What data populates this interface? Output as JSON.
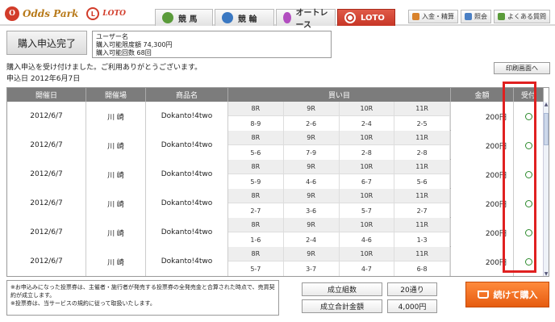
{
  "brand": {
    "logo": "Odds Park",
    "sub_logo": "LOTO"
  },
  "nav": [
    {
      "label": "競 馬",
      "icon": "horse-icon"
    },
    {
      "label": "競 輪",
      "icon": "bicycle-icon"
    },
    {
      "label": "オートレース",
      "icon": "motorcycle-icon"
    },
    {
      "label": "LOTO",
      "icon": "loto-icon",
      "active": true
    }
  ],
  "util": [
    {
      "label": "入金・精算",
      "icon": "yen-icon"
    },
    {
      "label": "照会",
      "icon": "document-icon"
    },
    {
      "label": "よくある質問",
      "icon": "help-icon"
    }
  ],
  "page": {
    "complete_label": "購入申込完了",
    "user_name_label": "ユーザー名",
    "limit_amount": "購入可能限度額 74,300円",
    "limit_count": "購入可能回数 68回",
    "message": "購入申込を受け付けました。ご利用ありがとうございます。",
    "date_line": "申込日 2012年6月7日",
    "print_label": "印刷画面へ"
  },
  "table": {
    "headers": {
      "date": "開催日",
      "venue": "開催場",
      "product": "商品名",
      "buy": "買い目",
      "amount": "金額",
      "status": "受付"
    },
    "rows": [
      {
        "date": "2012/6/7",
        "venue": "川 崎",
        "product": "Dokanto!4two",
        "races": [
          "8R",
          "9R",
          "10R",
          "11R"
        ],
        "picks": [
          "8-9",
          "2-6",
          "2-4",
          "2-5"
        ],
        "amount": "200円",
        "status": "○"
      },
      {
        "date": "2012/6/7",
        "venue": "川 崎",
        "product": "Dokanto!4two",
        "races": [
          "8R",
          "9R",
          "10R",
          "11R"
        ],
        "picks": [
          "5-6",
          "7-9",
          "2-8",
          "2-8"
        ],
        "amount": "200円",
        "status": "○"
      },
      {
        "date": "2012/6/7",
        "venue": "川 崎",
        "product": "Dokanto!4two",
        "races": [
          "8R",
          "9R",
          "10R",
          "11R"
        ],
        "picks": [
          "5-9",
          "4-6",
          "6-7",
          "5-6"
        ],
        "amount": "200円",
        "status": "○"
      },
      {
        "date": "2012/6/7",
        "venue": "川 崎",
        "product": "Dokanto!4two",
        "races": [
          "8R",
          "9R",
          "10R",
          "11R"
        ],
        "picks": [
          "2-7",
          "3-6",
          "5-7",
          "2-7"
        ],
        "amount": "200円",
        "status": "○"
      },
      {
        "date": "2012/6/7",
        "venue": "川 崎",
        "product": "Dokanto!4two",
        "races": [
          "8R",
          "9R",
          "10R",
          "11R"
        ],
        "picks": [
          "1-6",
          "2-4",
          "4-6",
          "1-3"
        ],
        "amount": "200円",
        "status": "○"
      },
      {
        "date": "2012/6/7",
        "venue": "川 崎",
        "product": "Dokanto!4two",
        "races": [
          "8R",
          "9R",
          "10R",
          "11R"
        ],
        "picks": [
          "5-7",
          "3-7",
          "4-7",
          "6-8"
        ],
        "amount": "200円",
        "status": "○"
      }
    ]
  },
  "footer": {
    "note_line1": "※お申込みになった投票券は、主催者・施行者が発売する投票券の全発売金と合算された時点で、売買契約が成立します。",
    "note_line2": "※投票券は、当サービスの規約に従って取扱いたします。",
    "total_count_label": "成立組数",
    "total_count_value": "20通り",
    "total_amount_label": "成立合計金額",
    "total_amount_value": "4,000円",
    "continue_label": "続けて購入"
  },
  "colors": {
    "accent": "#e65c10",
    "loto_red": "#c73626",
    "highlight": "#e02020",
    "ok_green": "#2e8b2e"
  }
}
